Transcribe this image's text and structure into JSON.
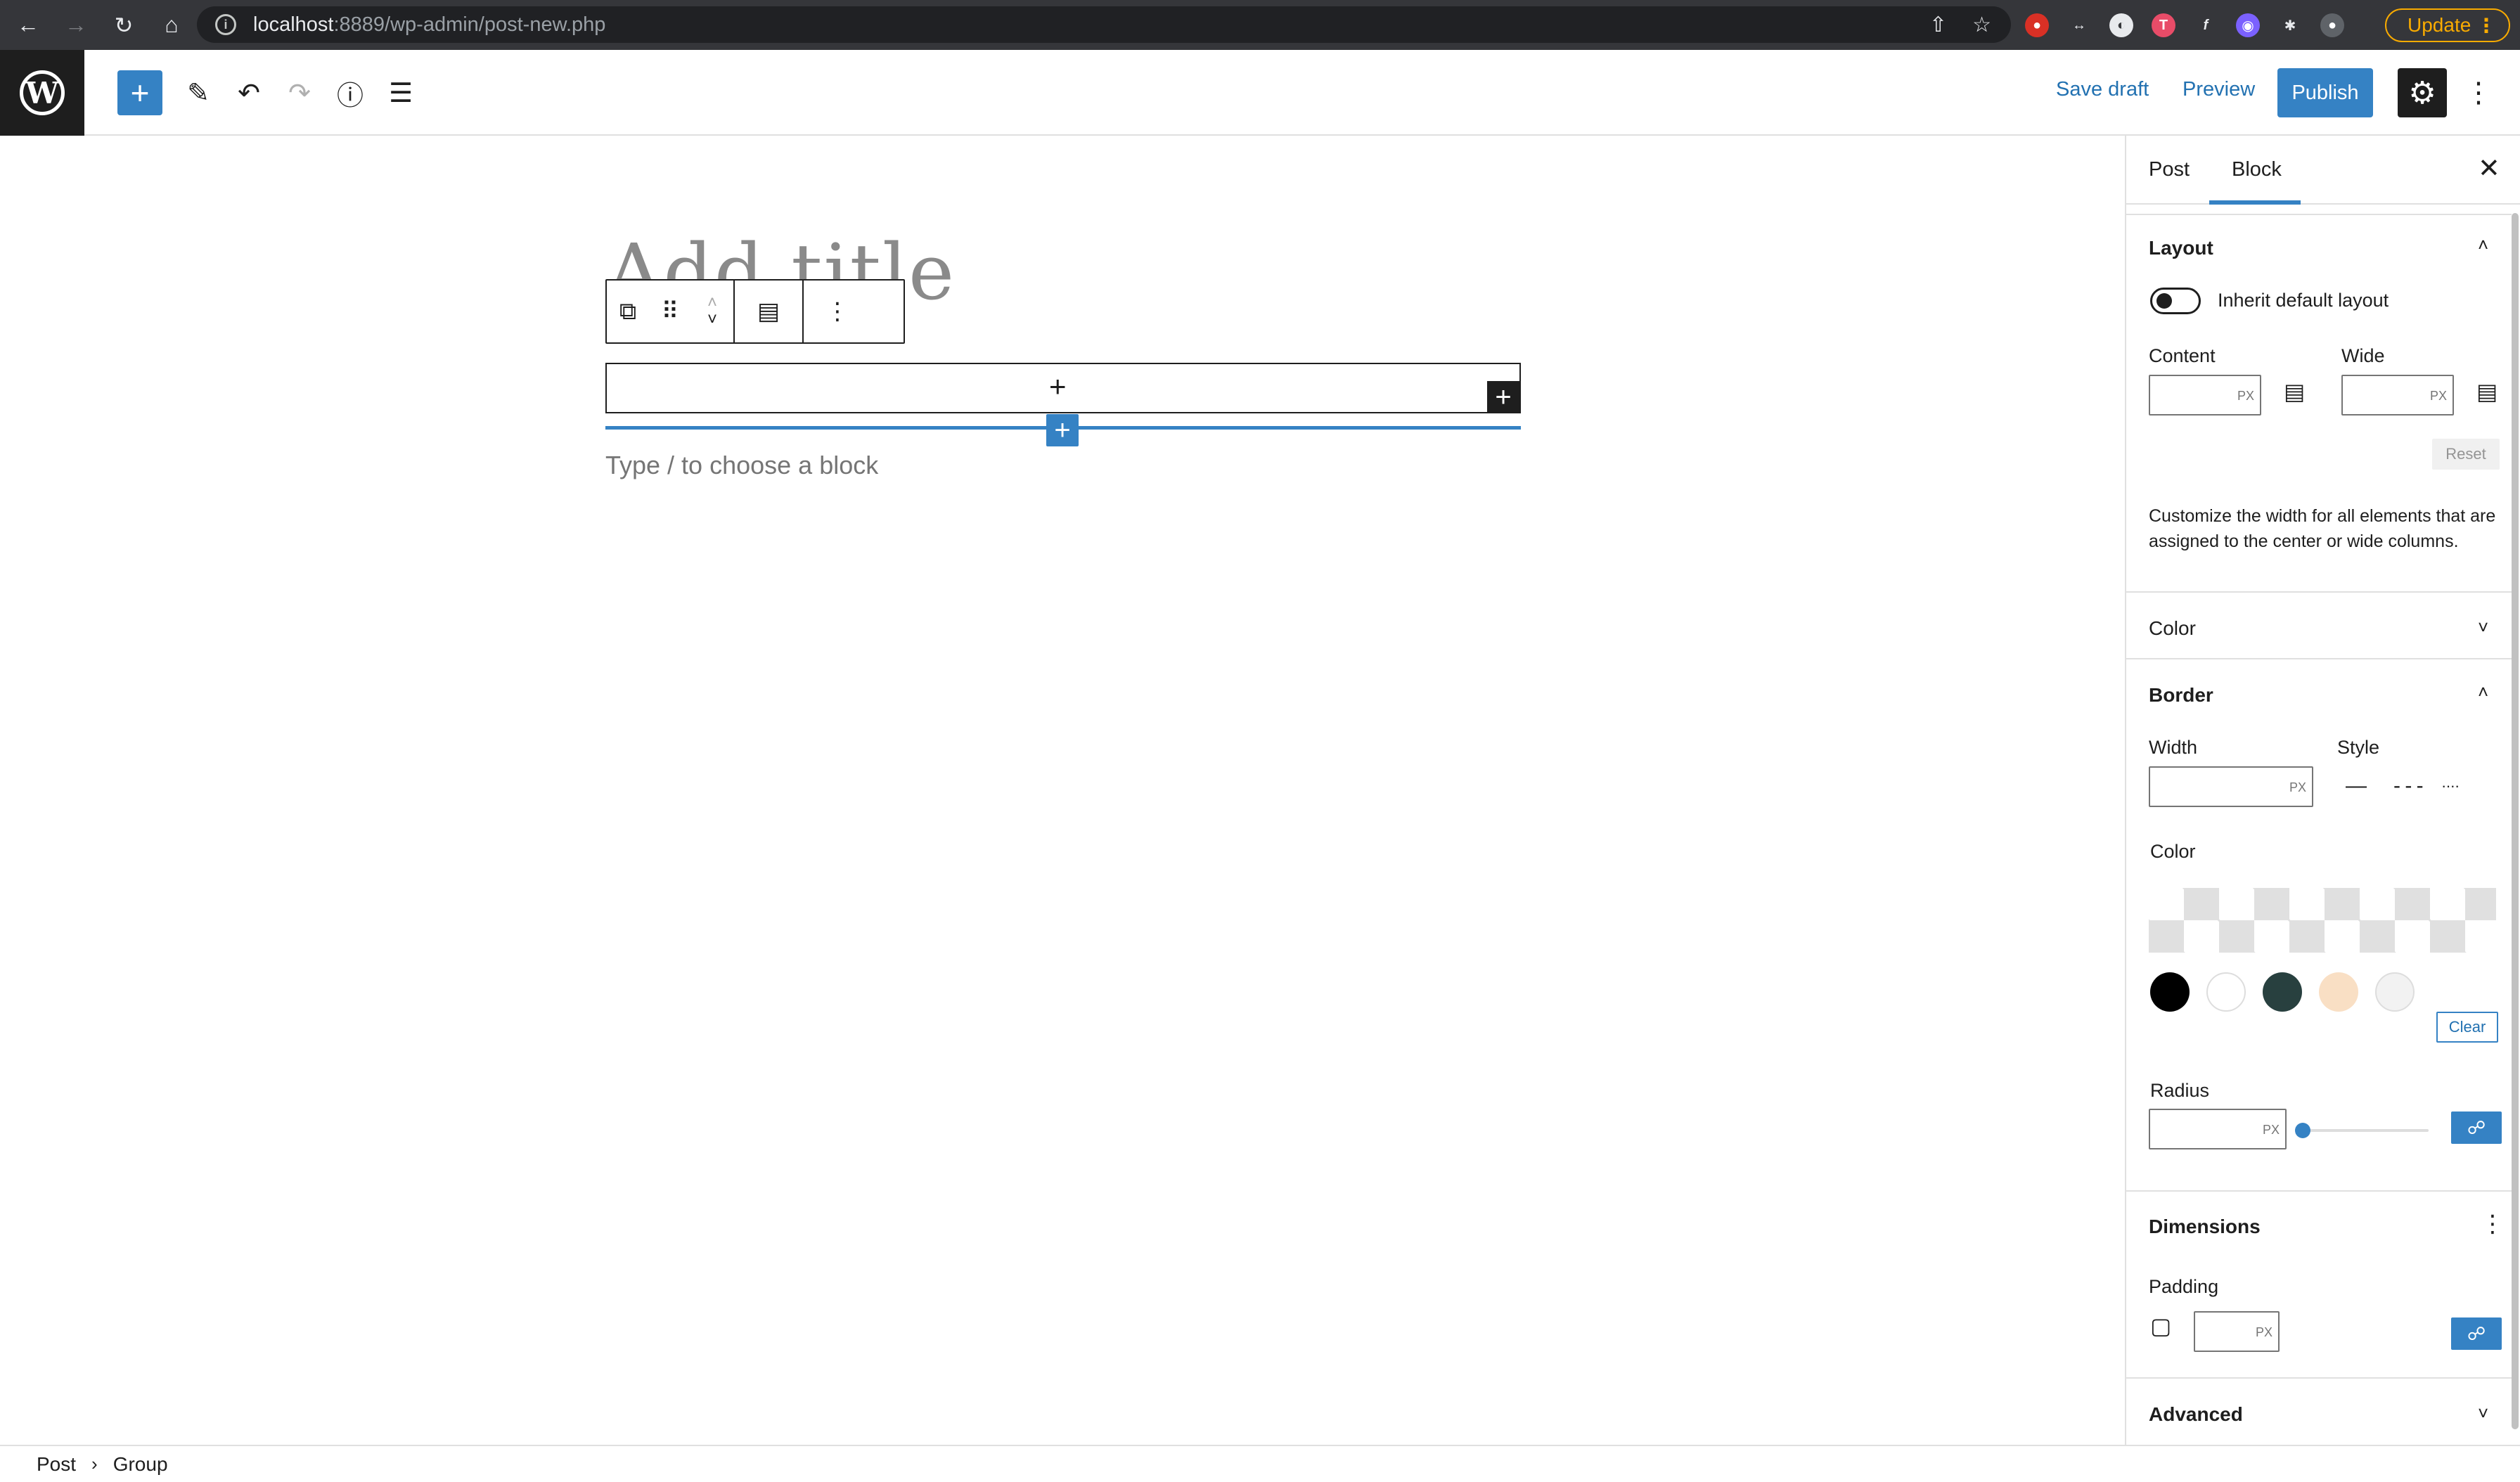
{
  "browser": {
    "url_host": "localhost",
    "url_rest": ":8889/wp-admin/post-new.php",
    "update_label": "Update"
  },
  "toolbar": {
    "logo_letter": "W",
    "save_draft_label": "Save draft",
    "preview_label": "Preview",
    "publish_label": "Publish"
  },
  "editor": {
    "title_placeholder": "Add title",
    "paragraph_placeholder": "Type / to choose a block"
  },
  "sidebar": {
    "tabs": [
      {
        "label": "Post"
      },
      {
        "label": "Block"
      }
    ],
    "active_tab": "Block",
    "layout": {
      "heading": "Layout",
      "inherit_label": "Inherit default layout",
      "inherit_checked": false,
      "content_label": "Content",
      "wide_label": "Wide",
      "unit": "PX",
      "reset_label": "Reset",
      "help_text": "Customize the width for all elements that are assigned to the center or wide columns."
    },
    "color": {
      "heading": "Color"
    },
    "border": {
      "heading": "Border",
      "width_label": "Width",
      "style_label": "Style",
      "color_label": "Color",
      "swatches": [
        "#000000",
        "#ffffff",
        "#28403f",
        "#f9dfc4",
        "#f2f2f2"
      ],
      "clear_label": "Clear",
      "radius_label": "Radius",
      "radius_value": 0
    },
    "dimensions": {
      "heading": "Dimensions",
      "padding_label": "Padding"
    },
    "advanced": {
      "heading": "Advanced"
    }
  },
  "breadcrumb": {
    "items": [
      "Post",
      "Group"
    ]
  },
  "colors": {
    "accent": "#3582c4",
    "dark": "#1e1e1e"
  }
}
